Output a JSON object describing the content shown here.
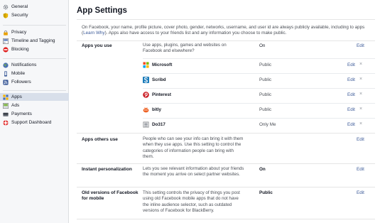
{
  "sidebar": {
    "items": [
      {
        "label": "General",
        "icon": "gear-icon"
      },
      {
        "label": "Security",
        "icon": "shield-icon"
      },
      {
        "label": "Privacy",
        "icon": "lock-icon"
      },
      {
        "label": "Timeline and Tagging",
        "icon": "timeline-icon"
      },
      {
        "label": "Blocking",
        "icon": "block-icon"
      },
      {
        "label": "Notifications",
        "icon": "globe-icon"
      },
      {
        "label": "Mobile",
        "icon": "phone-icon"
      },
      {
        "label": "Followers",
        "icon": "rss-icon"
      },
      {
        "label": "Apps",
        "icon": "apps-icon"
      },
      {
        "label": "Ads",
        "icon": "ads-icon"
      },
      {
        "label": "Payments",
        "icon": "card-icon"
      },
      {
        "label": "Support Dashboard",
        "icon": "lifebuoy-icon"
      }
    ],
    "active": "Apps"
  },
  "main": {
    "title": "App Settings",
    "intro_before": "On Facebook, your name, profile picture, cover photo, gender, networks, username, and user id are always publicly available, including to apps (",
    "intro_link": "Learn Why",
    "intro_after": "). Apps also have access to your friends list and any information you choose to make public.",
    "sections": [
      {
        "title": "Apps you use",
        "description": "Use apps, plugins, games and websites on Facebook and elsewhere?",
        "value": "On",
        "edit": "Edit",
        "apps": [
          {
            "name": "Microsoft",
            "privacy": "Public",
            "edit": "Edit",
            "remove": "×",
            "icon": "microsoft-icon"
          },
          {
            "name": "Scribd",
            "privacy": "Public",
            "edit": "Edit",
            "remove": "×",
            "icon": "scribd-icon"
          },
          {
            "name": "Pinterest",
            "privacy": "Public",
            "edit": "Edit",
            "remove": "×",
            "icon": "pinterest-icon"
          },
          {
            "name": "bitly",
            "privacy": "Public",
            "edit": "Edit",
            "remove": "×",
            "icon": "bitly-icon"
          },
          {
            "name": "Do317",
            "privacy": "Only Me",
            "edit": "Edit",
            "remove": "×",
            "icon": "do317-icon"
          }
        ]
      },
      {
        "title": "Apps others use",
        "description": "People who can see your info can bring it with them when they use apps. Use this setting to control the categories of information people can bring with them.",
        "value": "",
        "edit": "Edit"
      },
      {
        "title": "Instant personalization",
        "description": "Lets you see relevant information about your friends the moment you arrive on select partner websites.",
        "value": "On",
        "edit": "Edit"
      },
      {
        "title": "Old versions of Facebook for mobile",
        "description": "This setting controls the privacy of things you post using old Facebook mobile apps that do not have the inline audience selector, such as outdated versions of Facebook for BlackBerry.",
        "value": "Public",
        "edit": "Edit"
      }
    ]
  },
  "colors": {
    "link": "#3b5998",
    "sidebar_bg": "#f6f7f9",
    "active_bg": "#d8dfea"
  }
}
